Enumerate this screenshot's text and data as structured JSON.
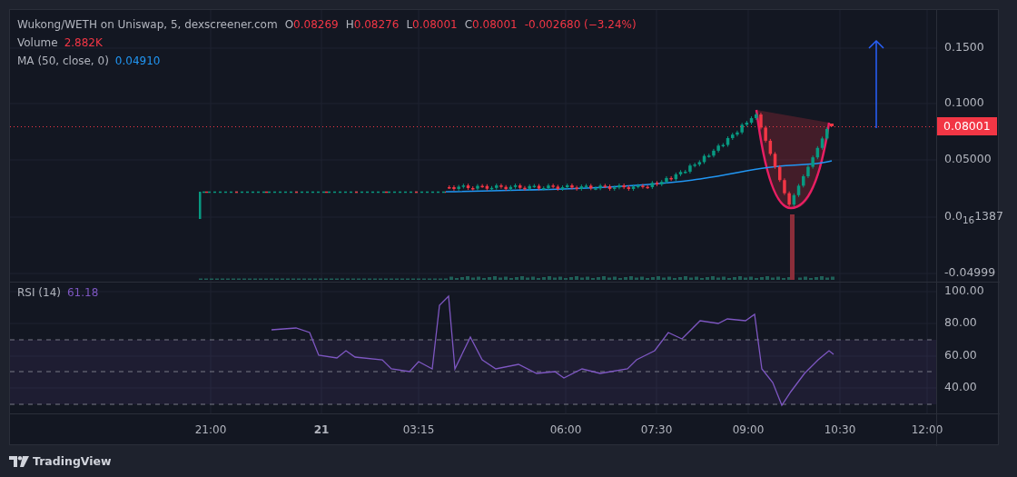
{
  "legend": {
    "symbol": "Wukong/WETH on Uniswap, 5, dexscreener.com",
    "ohlc": [
      {
        "label": "O",
        "value": "0.08269"
      },
      {
        "label": "H",
        "value": "0.08276"
      },
      {
        "label": "L",
        "value": "0.08001"
      },
      {
        "label": "C",
        "value": "0.08001"
      }
    ],
    "change": "-0.002680 (−3.24%)",
    "volume": {
      "label": "Volume",
      "value": "2.882K"
    },
    "ma": {
      "label": "MA (50, close, 0)",
      "value": "0.04910"
    }
  },
  "price_axis": [
    "0.1500",
    "0.1000",
    "0.05000",
    "0.0$_{16}$1387",
    "-0.04999"
  ],
  "last_price": "0.08001",
  "rsi": {
    "label": "RSI (14)",
    "value": "61.18",
    "axis": [
      "100.00",
      "80.00",
      "60.00",
      "40.00"
    ]
  },
  "time_axis": [
    {
      "label": "21:00",
      "kind": "time"
    },
    {
      "label": "21",
      "kind": "day"
    },
    {
      "label": "03:15",
      "kind": "time"
    },
    {
      "label": "06:00",
      "kind": "time"
    },
    {
      "label": "07:30",
      "kind": "time"
    },
    {
      "label": "09:00",
      "kind": "time"
    },
    {
      "label": "10:30",
      "kind": "time"
    },
    {
      "label": "12:00",
      "kind": "time"
    }
  ],
  "footer": {
    "brand": "TradingView"
  }
}
